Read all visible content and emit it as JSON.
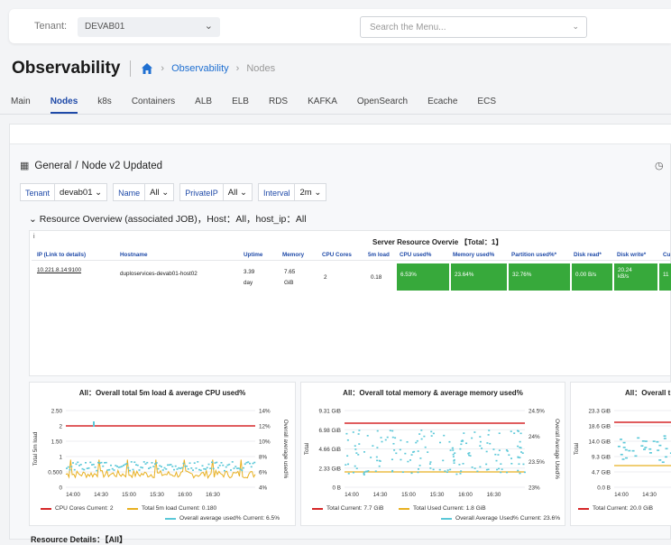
{
  "header": {
    "tenant_label": "Tenant:",
    "tenant_value": "DEVAB01",
    "search_placeholder": "Search the Menu..."
  },
  "page": {
    "title": "Observability",
    "breadcrumb": [
      "Observability",
      "Nodes"
    ]
  },
  "tabs": [
    "Main",
    "Nodes",
    "k8s",
    "Containers",
    "ALB",
    "ELB",
    "RDS",
    "KAFKA",
    "OpenSearch",
    "Ecache",
    "ECS"
  ],
  "active_tab": "Nodes",
  "dashboard": {
    "folder": "General",
    "name": "Node v2 Updated",
    "variables": [
      {
        "label": "Tenant",
        "value": "devab01 ⌄"
      },
      {
        "label": "Name",
        "value": "All ⌄"
      },
      {
        "label": "PrivateIP",
        "value": "All ⌄"
      },
      {
        "label": "Interval",
        "value": "2m ⌄"
      }
    ],
    "row_title": "⌄ Resource Overview (associated JOB)，Host：All，host_ip：All"
  },
  "table": {
    "title": "Server Resource Overvie 【Total：1】",
    "info": "i",
    "columns": [
      "IP (Link to details)",
      "Hostname",
      "Uptime",
      "Memory",
      "CPU Cores",
      "5m load",
      "CPU used%",
      "Memory used%",
      "Partition used%*",
      "Disk read*",
      "Disk write*",
      "Cu"
    ],
    "row": {
      "ip": "10.221.8.14:9100",
      "hostname": "duploservices-devab01-host02",
      "uptime_1": "3.39",
      "uptime_2": "day",
      "memory_1": "7.65",
      "memory_2": "GiB",
      "cpu_cores": "2",
      "load5": "0.18",
      "cpu_used": "6.53%",
      "mem_used": "23.64%",
      "part_used": "32.76%",
      "disk_read": "0.00 B/s",
      "disk_write_1": "20.24",
      "disk_write_2": "kB/s",
      "cu": "11"
    }
  },
  "charts": [
    {
      "title": "All：Overall total 5m load & average CPU used%",
      "ylabel": "Total 5m load",
      "y2label": "Overall average used%",
      "yticks": [
        "2.50",
        "2",
        "1.50",
        "1",
        "0.500",
        "0"
      ],
      "y2ticks": [
        "14%",
        "12%",
        "10%",
        "8%",
        "6%",
        "4%"
      ],
      "xticks": [
        "14:00",
        "14:30",
        "15:00",
        "15:30",
        "16:00",
        "16:30"
      ],
      "legend": [
        {
          "text": "CPU Cores  Current: 2",
          "color": "#d62728"
        },
        {
          "text": "Total 5m load  Current: 0.180",
          "color": "#e8b020"
        },
        {
          "text": "Overall average used%  Current: 6.5%",
          "color": "#5bc8d8"
        }
      ]
    },
    {
      "title": "All：Overall total memory & average memory used%",
      "ylabel": "Total",
      "y2label": "Overall Average Used%",
      "yticks": [
        "9.31 GiB",
        "6.98 GiB",
        "4.66 GiB",
        "2.33 GiB",
        "0 B"
      ],
      "y2ticks": [
        "24.5%",
        "24%",
        "23.5%",
        "23%"
      ],
      "xticks": [
        "14:00",
        "14:30",
        "15:00",
        "15:30",
        "16:00",
        "16:30"
      ],
      "legend": [
        {
          "text": "Total  Current: 7.7 GiB",
          "color": "#d62728"
        },
        {
          "text": "Total Used  Current: 1.8 GiB",
          "color": "#e8b020"
        },
        {
          "text": "Overall Average Used%  Current: 23.6%",
          "color": "#5bc8d8"
        }
      ]
    },
    {
      "title": "All：Overall t",
      "ylabel": "Total",
      "yticks": [
        "23.3 GiB",
        "18.6 GiB",
        "14.0 GiB",
        "9.3 GiB",
        "4.7 GiB",
        "0.0 B"
      ],
      "xticks": [
        "14:00",
        "14:30",
        "1"
      ],
      "legend": [
        {
          "text": "Total  Current: 20.0 GiB",
          "color": "#d62728"
        }
      ]
    }
  ],
  "bottom_row_title": "Resource Details：【All】",
  "colors": {
    "accent": "#1f4aa8",
    "green": "#37a93b",
    "red": "#d62728",
    "yellow": "#e8b020",
    "cyan": "#5bc8d8"
  }
}
